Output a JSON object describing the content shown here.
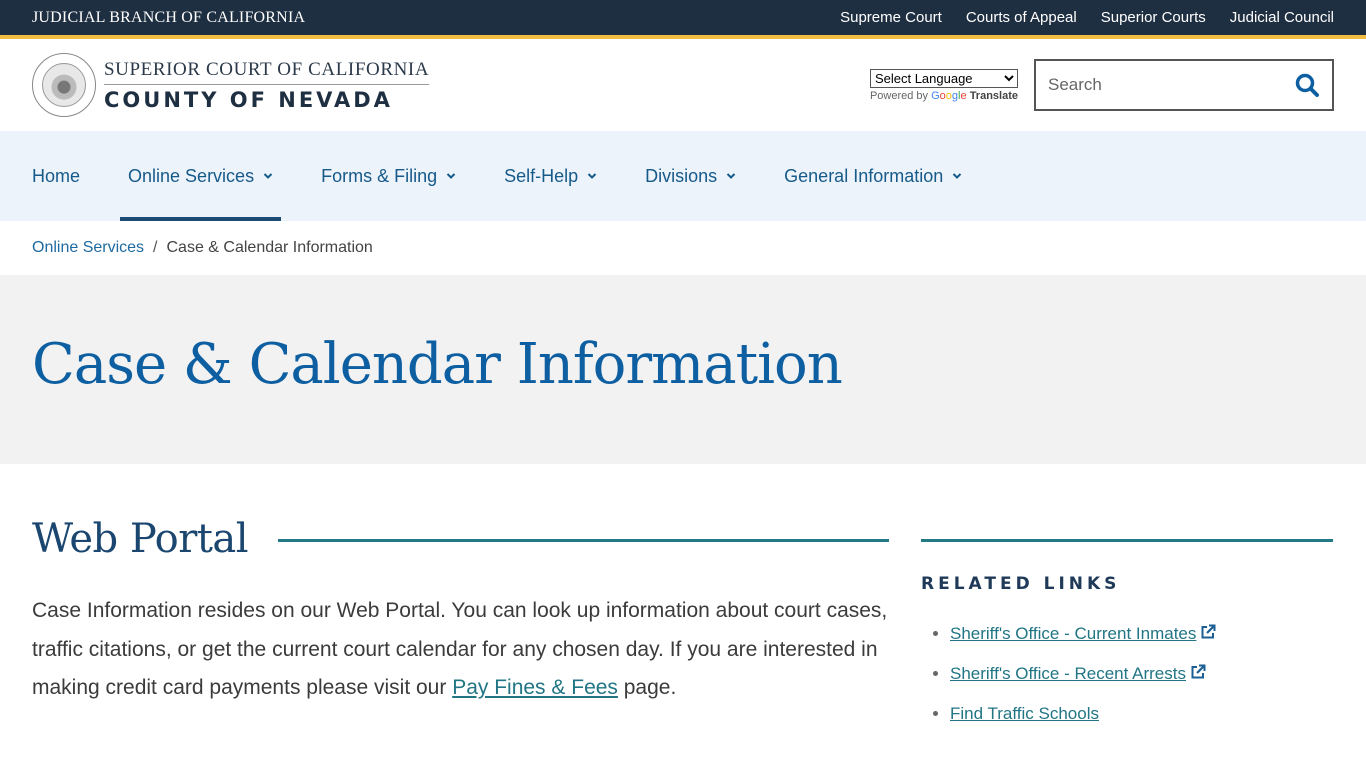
{
  "topbar": {
    "brand": "JUDICIAL BRANCH OF CALIFORNIA",
    "links": [
      "Supreme Court",
      "Courts of Appeal",
      "Superior Courts",
      "Judicial Council"
    ]
  },
  "header": {
    "logo_line1": "SUPERIOR COURT OF CALIFORNIA",
    "logo_line2": "COUNTY OF NEVADA",
    "language_select": "Select Language",
    "powered_by": "Powered by",
    "google": [
      "G",
      "o",
      "o",
      "g",
      "l",
      "e"
    ],
    "translate": "Translate",
    "search_placeholder": "Search"
  },
  "nav": {
    "items": [
      {
        "label": "Home",
        "dropdown": false
      },
      {
        "label": "Online Services",
        "dropdown": true,
        "active": true
      },
      {
        "label": "Forms & Filing",
        "dropdown": true
      },
      {
        "label": "Self-Help",
        "dropdown": true
      },
      {
        "label": "Divisions",
        "dropdown": true
      },
      {
        "label": "General Information",
        "dropdown": true
      }
    ]
  },
  "breadcrumb": {
    "parent": "Online Services",
    "separator": "/",
    "current": "Case & Calendar Information"
  },
  "page": {
    "title": "Case & Calendar Information"
  },
  "main": {
    "section_title": "Web Portal",
    "paragraph_before_link": "Case Information resides on our Web Portal. You can look up information about court cases, traffic citations, or get the current court calendar for any chosen day. If you are interested in making credit card payments please visit our ",
    "link_text": "Pay Fines & Fees",
    "paragraph_after_link": " page."
  },
  "aside": {
    "title": "RELATED LINKS",
    "links": [
      {
        "label": "Sheriff's Office - Current Inmates",
        "external": true
      },
      {
        "label": "Sheriff's Office - Recent Arrests",
        "external": true
      },
      {
        "label": "Find Traffic Schools",
        "external": false
      }
    ]
  },
  "colors": {
    "topbar_bg": "#1f2f42",
    "topbar_accent": "#f2be42",
    "nav_bg": "#edf3fa",
    "link_teal": "#217584",
    "title_blue": "#0d5fa1"
  }
}
